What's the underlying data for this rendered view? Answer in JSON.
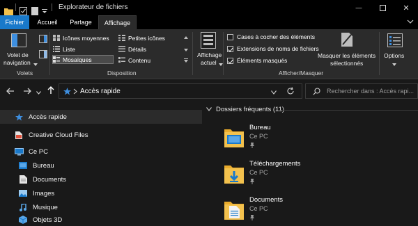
{
  "window": {
    "title": "Explorateur de fichiers",
    "minimize_glyph": "—",
    "maximize_glyph": "☐",
    "close_glyph": "✕"
  },
  "tabs": [
    {
      "label": "Fichier"
    },
    {
      "label": "Accueil"
    },
    {
      "label": "Partage"
    },
    {
      "label": "Affichage"
    }
  ],
  "ribbon": {
    "panes": {
      "navigation_pane_label_1": "Volet de",
      "navigation_pane_label_2": "navigation",
      "group_label": "Volets"
    },
    "layout": {
      "items": [
        {
          "label": "Icônes moyennes"
        },
        {
          "label": "Petites icônes"
        },
        {
          "label": "Liste"
        },
        {
          "label": "Détails"
        },
        {
          "label": "Mosaïques"
        },
        {
          "label": "Contenu"
        }
      ],
      "selected": "Mosaïques",
      "group_label": "Disposition"
    },
    "current_view": {
      "label_1": "Affichage",
      "label_2": "actuel"
    },
    "show_hide": {
      "checkboxes": [
        {
          "label": "Cases à cocher des éléments",
          "checked": false
        },
        {
          "label": "Extensions de noms de fichiers",
          "checked": true
        },
        {
          "label": "Éléments masqués",
          "checked": true
        }
      ],
      "hide_selected_label_1": "Masquer les éléments",
      "hide_selected_label_2": "sélectionnés",
      "group_label": "Afficher/Masquer"
    },
    "options": {
      "label": "Options"
    }
  },
  "address_bar": {
    "path": "Accès rapide",
    "search_placeholder": "Rechercher dans : Accès rapi..."
  },
  "nav_pane": {
    "items": [
      {
        "label": "Accès rapide",
        "icon": "star-icon"
      },
      {
        "label": "Creative Cloud Files",
        "icon": "creative-cloud-icon"
      },
      {
        "label": "Ce PC",
        "icon": "computer-icon"
      },
      {
        "label": "Bureau",
        "icon": "desktop-folder-icon"
      },
      {
        "label": "Documents",
        "icon": "documents-folder-icon"
      },
      {
        "label": "Images",
        "icon": "images-folder-icon"
      },
      {
        "label": "Musique",
        "icon": "music-folder-icon"
      },
      {
        "label": "Objets 3D",
        "icon": "3d-objects-folder-icon"
      }
    ]
  },
  "content": {
    "section_title": "Dossiers fréquents (11)",
    "folders": [
      {
        "name": "Bureau",
        "location": "Ce PC"
      },
      {
        "name": "Téléchargements",
        "location": "Ce PC"
      },
      {
        "name": "Documents",
        "location": "Ce PC"
      }
    ]
  },
  "colors": {
    "accent": "#1979ca",
    "background": "#191919",
    "ribbon": "#2b2b2b",
    "folder": "#f3c14d"
  }
}
